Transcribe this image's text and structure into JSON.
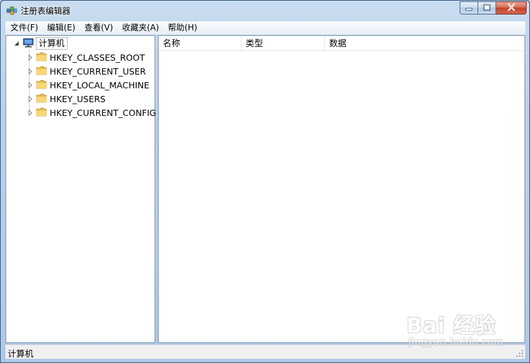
{
  "window": {
    "title": "注册表编辑器",
    "app_icon": "regedit-icon",
    "controls": [
      "minimize-icon",
      "maximize-icon",
      "close-icon"
    ]
  },
  "menu": {
    "items": [
      {
        "label": "文件(F)"
      },
      {
        "label": "编辑(E)"
      },
      {
        "label": "查看(V)"
      },
      {
        "label": "收藏夹(A)"
      },
      {
        "label": "帮助(H)"
      }
    ]
  },
  "tree": {
    "root": {
      "label": "计算机",
      "icon": "computer-icon",
      "expanded": true
    },
    "keys": [
      {
        "label": "HKEY_CLASSES_ROOT",
        "icon": "folder-icon"
      },
      {
        "label": "HKEY_CURRENT_USER",
        "icon": "folder-icon"
      },
      {
        "label": "HKEY_LOCAL_MACHINE",
        "icon": "folder-icon"
      },
      {
        "label": "HKEY_USERS",
        "icon": "folder-icon"
      },
      {
        "label": "HKEY_CURRENT_CONFIG",
        "icon": "folder-icon"
      }
    ]
  },
  "list": {
    "columns": [
      "名称",
      "类型",
      "数据"
    ],
    "rows": []
  },
  "status": {
    "text": "计算机"
  },
  "watermark": {
    "logo": "Bai 经验",
    "url": "jingyan.baidu.com"
  },
  "colors": {
    "title_bar": "#b9d1ea",
    "close_button": "#c2412a",
    "folder": "#f2cf63",
    "pane_border": "#8297ac"
  }
}
